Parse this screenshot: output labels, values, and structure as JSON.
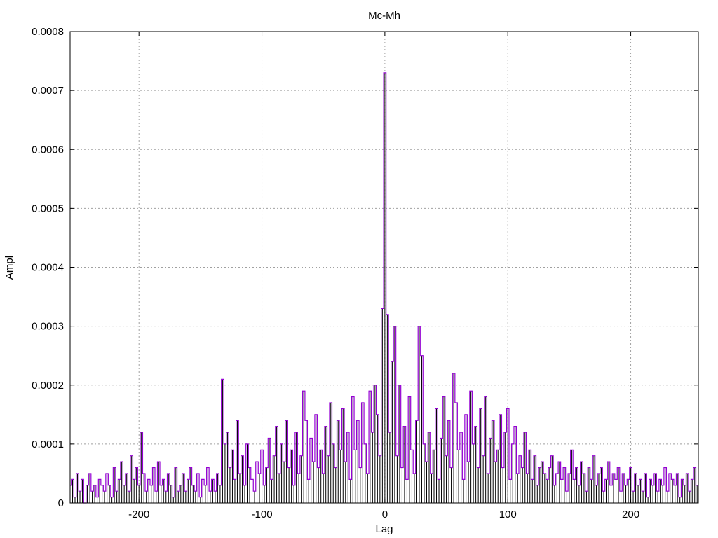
{
  "chart_data": {
    "type": "line",
    "title": "Mc-Mh",
    "xlabel": "Lag",
    "ylabel": "Ampl",
    "xlim": [
      -256,
      255
    ],
    "ylim": [
      0,
      0.0008
    ],
    "grid": true,
    "xticks": [
      -200,
      -100,
      0,
      100,
      200
    ],
    "xtick_labels": [
      "-200",
      "-100",
      "0",
      "100",
      "200"
    ],
    "yticks": [
      0,
      0.0001,
      0.0002,
      0.0003,
      0.0004,
      0.0005,
      0.0006,
      0.0007,
      0.0008
    ],
    "ytick_labels": [
      "0",
      "0.0001",
      "0.0002",
      "0.0003",
      "0.0004",
      "0.0005",
      "0.0006",
      "0.0007",
      "0.0008"
    ],
    "x_start": -256,
    "x_step": 2,
    "value_scale": 1e-05,
    "series": [
      {
        "name": "Mc-Mh",
        "color": "#9400d3",
        "impulse_color": "#000000",
        "values": [
          3,
          4,
          1,
          5,
          2,
          4,
          0,
          3,
          5,
          2,
          3,
          1,
          4,
          3,
          2,
          5,
          3,
          1,
          6,
          2,
          4,
          7,
          3,
          5,
          2,
          8,
          4,
          6,
          3,
          12,
          5,
          2,
          4,
          3,
          6,
          2,
          7,
          3,
          4,
          2,
          5,
          3,
          1,
          6,
          2,
          3,
          5,
          2,
          4,
          6,
          3,
          2,
          5,
          1,
          4,
          3,
          6,
          2,
          4,
          2,
          5,
          3,
          21,
          10,
          12,
          6,
          9,
          4,
          14,
          5,
          8,
          3,
          10,
          6,
          4,
          2,
          7,
          5,
          9,
          3,
          6,
          11,
          4,
          8,
          13,
          5,
          10,
          7,
          14,
          6,
          9,
          3,
          12,
          5,
          8,
          19,
          14,
          4,
          11,
          7,
          15,
          6,
          9,
          5,
          13,
          8,
          17,
          10,
          6,
          14,
          9,
          16,
          7,
          12,
          4,
          18,
          9,
          14,
          6,
          17,
          10,
          5,
          19,
          12,
          20,
          15,
          8,
          33,
          73,
          32,
          12,
          24,
          30,
          8,
          20,
          6,
          13,
          4,
          18,
          9,
          5,
          14,
          30,
          25,
          10,
          7,
          12,
          5,
          9,
          16,
          4,
          11,
          18,
          8,
          14,
          6,
          22,
          17,
          9,
          12,
          4,
          15,
          7,
          19,
          10,
          13,
          6,
          16,
          8,
          18,
          5,
          11,
          14,
          7,
          9,
          15,
          6,
          12,
          16,
          4,
          10,
          13,
          5,
          8,
          6,
          12,
          5,
          9,
          4,
          8,
          3,
          6,
          7,
          5,
          4,
          6,
          8,
          3,
          5,
          7,
          4,
          6,
          2,
          5,
          9,
          4,
          6,
          3,
          7,
          5,
          2,
          6,
          4,
          8,
          3,
          5,
          6,
          2,
          4,
          7,
          3,
          5,
          4,
          6,
          2,
          5,
          3,
          4,
          6,
          2,
          5,
          3,
          4,
          2,
          5,
          1,
          4,
          3,
          5,
          2,
          4,
          3,
          6,
          2,
          5,
          4,
          3,
          5,
          1,
          4,
          3,
          5,
          2,
          4,
          6,
          3
        ]
      }
    ]
  }
}
